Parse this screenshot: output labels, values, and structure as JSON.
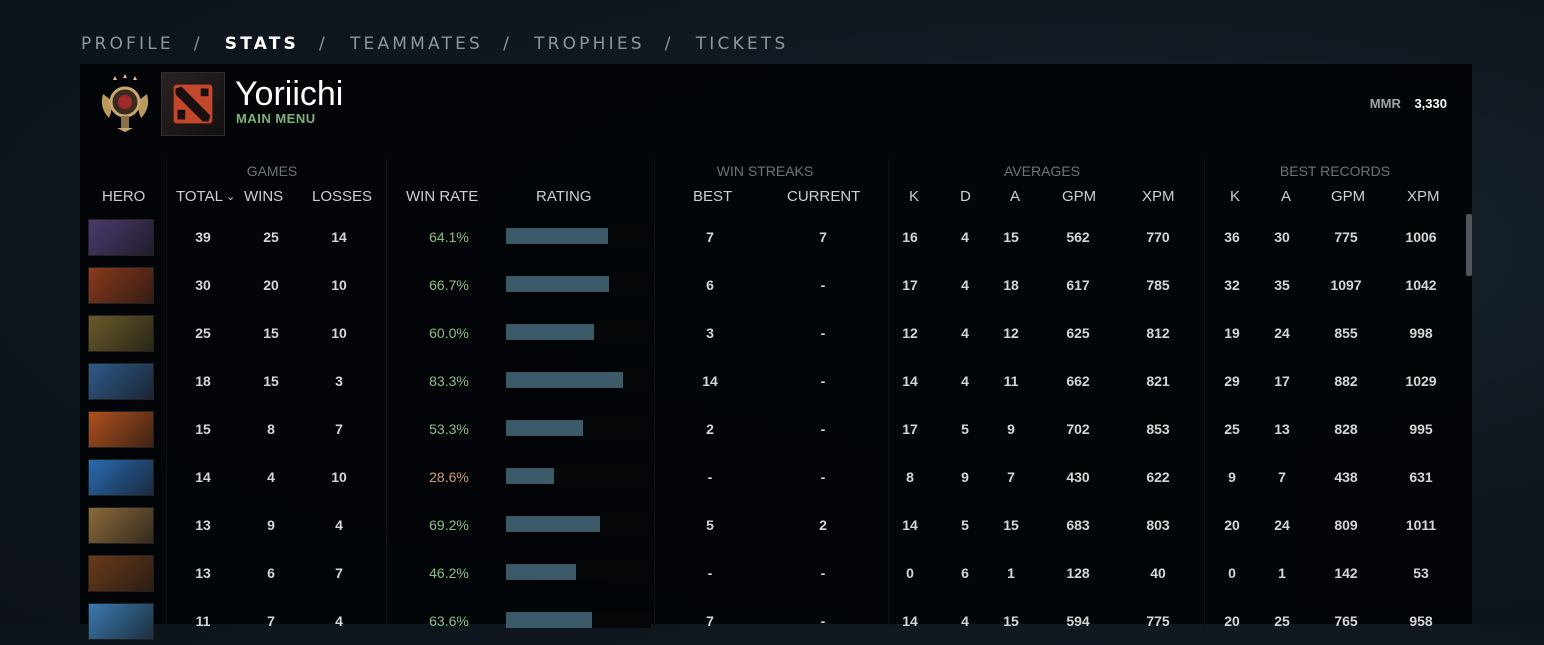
{
  "nav": {
    "items": [
      {
        "label": "PROFILE",
        "active": false
      },
      {
        "label": "STATS",
        "active": true
      },
      {
        "label": "TEAMMATES",
        "active": false
      },
      {
        "label": "TROPHIES",
        "active": false
      },
      {
        "label": "TICKETS",
        "active": false
      }
    ],
    "separator": "/"
  },
  "profile": {
    "username": "Yoriichi",
    "subtitle": "MAIN MENU",
    "mmr_label": "MMR",
    "mmr_value": "3,330"
  },
  "groups": {
    "games": "GAMES",
    "win_streaks": "WIN STREAKS",
    "averages": "AVERAGES",
    "best_records": "BEST RECORDS"
  },
  "columns": {
    "hero": "HERO",
    "total": "TOTAL",
    "wins": "WINS",
    "losses": "LOSSES",
    "win_rate": "WIN RATE",
    "rating": "RATING",
    "best": "BEST",
    "current": "CURRENT",
    "k": "K",
    "d": "D",
    "a": "A",
    "gpm": "GPM",
    "xpm": "XPM",
    "best_k": "K",
    "best_a": "A",
    "best_gpm": "GPM",
    "best_xpm": "XPM"
  },
  "rows": [
    {
      "hero_icon": "hero-portrait-purple",
      "hero_color": "#4a3a6e",
      "total": "39",
      "wins": "25",
      "losses": "14",
      "win_rate": "64.1%",
      "rating": 0.7,
      "best": "7",
      "current": "7",
      "k": "16",
      "d": "4",
      "a": "15",
      "gpm": "562",
      "xpm": "770",
      "bk": "36",
      "ba": "30",
      "bgpm": "775",
      "bxpm": "1006",
      "low": false
    },
    {
      "hero_icon": "hero-portrait-orange",
      "hero_color": "#8a3a1a",
      "total": "30",
      "wins": "20",
      "losses": "10",
      "win_rate": "66.7%",
      "rating": 0.71,
      "best": "6",
      "current": "-",
      "k": "17",
      "d": "4",
      "a": "18",
      "gpm": "617",
      "xpm": "785",
      "bk": "32",
      "ba": "35",
      "bgpm": "1097",
      "bxpm": "1042",
      "low": false
    },
    {
      "hero_icon": "hero-portrait-monkey",
      "hero_color": "#6a5a2a",
      "total": "25",
      "wins": "15",
      "losses": "10",
      "win_rate": "60.0%",
      "rating": 0.61,
      "best": "3",
      "current": "-",
      "k": "12",
      "d": "4",
      "a": "12",
      "gpm": "625",
      "xpm": "812",
      "bk": "19",
      "ba": "24",
      "bgpm": "855",
      "bxpm": "998",
      "low": false
    },
    {
      "hero_icon": "hero-portrait-blue",
      "hero_color": "#2f5a8a",
      "total": "18",
      "wins": "15",
      "losses": "3",
      "win_rate": "83.3%",
      "rating": 0.81,
      "best": "14",
      "current": "-",
      "k": "14",
      "d": "4",
      "a": "11",
      "gpm": "662",
      "xpm": "821",
      "bk": "29",
      "ba": "17",
      "bgpm": "882",
      "bxpm": "1029",
      "low": false
    },
    {
      "hero_icon": "hero-portrait-lina",
      "hero_color": "#b0501e",
      "total": "15",
      "wins": "8",
      "losses": "7",
      "win_rate": "53.3%",
      "rating": 0.53,
      "best": "2",
      "current": "-",
      "k": "17",
      "d": "5",
      "a": "9",
      "gpm": "702",
      "xpm": "853",
      "bk": "25",
      "ba": "13",
      "bgpm": "828",
      "bxpm": "995",
      "low": false
    },
    {
      "hero_icon": "hero-portrait-storm",
      "hero_color": "#2a6ab0",
      "total": "14",
      "wins": "4",
      "losses": "10",
      "win_rate": "28.6%",
      "rating": 0.33,
      "best": "-",
      "current": "-",
      "k": "8",
      "d": "9",
      "a": "7",
      "gpm": "430",
      "xpm": "622",
      "bk": "9",
      "ba": "7",
      "bgpm": "438",
      "bxpm": "631",
      "low": true
    },
    {
      "hero_icon": "hero-portrait-juggernaut",
      "hero_color": "#8a6a3a",
      "total": "13",
      "wins": "9",
      "losses": "4",
      "win_rate": "69.2%",
      "rating": 0.65,
      "best": "5",
      "current": "2",
      "k": "14",
      "d": "5",
      "a": "15",
      "gpm": "683",
      "xpm": "803",
      "bk": "20",
      "ba": "24",
      "bgpm": "809",
      "bxpm": "1011",
      "low": false
    },
    {
      "hero_icon": "hero-portrait-earth",
      "hero_color": "#6a3a1a",
      "total": "13",
      "wins": "6",
      "losses": "7",
      "win_rate": "46.2%",
      "rating": 0.48,
      "best": "-",
      "current": "-",
      "k": "0",
      "d": "6",
      "a": "1",
      "gpm": "128",
      "xpm": "40",
      "bk": "0",
      "ba": "1",
      "bgpm": "142",
      "bxpm": "53",
      "low": false
    },
    {
      "hero_icon": "hero-portrait-kunkka",
      "hero_color": "#3a7ab0",
      "total": "11",
      "wins": "7",
      "losses": "4",
      "win_rate": "63.6%",
      "rating": 0.59,
      "best": "7",
      "current": "-",
      "k": "14",
      "d": "4",
      "a": "15",
      "gpm": "594",
      "xpm": "775",
      "bk": "20",
      "ba": "25",
      "bgpm": "765",
      "bxpm": "958",
      "low": false
    }
  ]
}
